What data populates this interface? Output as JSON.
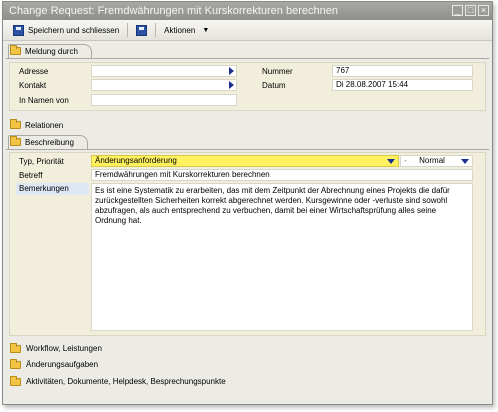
{
  "window": {
    "title": "Change Request: Fremdwährungen mit Kurskorrekturen berechnen",
    "buttons": [
      "_",
      "□",
      "×"
    ]
  },
  "toolbar": {
    "save_close_label": "Speichern und schliessen",
    "actions_label": "Aktionen"
  },
  "meldung": {
    "section_label": "Meldung durch",
    "adresse_label": "Adresse",
    "adresse_value": "",
    "kontakt_label": "Kontakt",
    "kontakt_value": "",
    "in_namen_label": "In Namen von",
    "in_namen_value": "",
    "nummer_label": "Nummer",
    "nummer_value": "767",
    "datum_label": "Datum",
    "datum_value": "Di 28.08.2007 15:44"
  },
  "relationen": {
    "section_label": "Relationen"
  },
  "beschreibung": {
    "section_label": "Beschreibung",
    "typ_label": "Typ, Priorität",
    "typ_value": "Änderungsanforderung",
    "prio_dash": "-",
    "prio_value": "Normal",
    "betreff_label": "Betreff",
    "betreff_value": "Fremdwährungen mit Kurskorrekturen berechnen",
    "bemerkungen_label": "Bemerkungen",
    "bemerkungen_value": "Es ist eine Systematik zu erarbeiten, das mit dem Zeitpunkt der Abrechnung eines Projekts die dafür zurückgestellten Sicherheiten korrekt abgerechnet werden. Kursgewinne oder -verluste sind sowohl abzufragen, als auch entsprechend zu verbuchen, damit bei einer Wirtschaftsprüfung alles seine Ordnung hat."
  },
  "bottom_sections": [
    "Workflow, Leistungen",
    "Änderungsaufgaben",
    "Aktivitäten, Dokumente, Helpdesk, Besprechungspunkte"
  ]
}
